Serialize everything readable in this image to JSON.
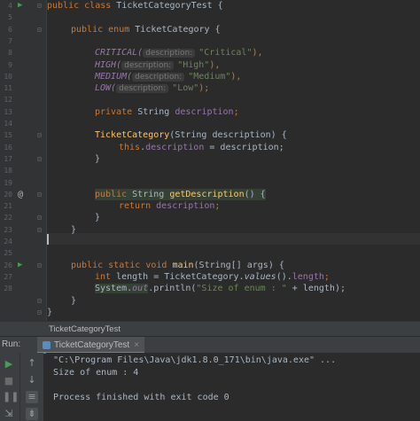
{
  "gutter": {
    "line_numbers": [
      "4",
      "5",
      "6",
      "7",
      "8",
      "9",
      "10",
      "11",
      "12",
      "13",
      "14",
      "15",
      "16",
      "17",
      "18",
      "19",
      "20",
      "21",
      "22",
      "23",
      "24",
      "25",
      "26",
      "27",
      "28"
    ],
    "override_marker": "@"
  },
  "code": {
    "class_decl": {
      "kw1": "public",
      "kw2": "class",
      "name": "TicketCategoryTest {"
    },
    "enum_decl": {
      "kw1": "public",
      "kw2": "enum",
      "name": "TicketCategory {"
    },
    "enums": [
      {
        "name": "CRITICAL(",
        "hint": "description:",
        "value": "\"Critical\"",
        "end": "),"
      },
      {
        "name": "HIGH(",
        "hint": "description:",
        "value": "\"High\"",
        "end": "),"
      },
      {
        "name": "MEDIUM(",
        "hint": "description:",
        "value": "\"Medium\"",
        "end": "),"
      },
      {
        "name": "LOW(",
        "hint": "description:",
        "value": "\"Low\"",
        "end": ");"
      }
    ],
    "field_decl": {
      "kw": "private",
      "type": "String",
      "name": "description",
      "end": ";"
    },
    "ctor_decl": {
      "name": "TicketCategory",
      "params": "(String description) {"
    },
    "ctor_body": {
      "kw": "this",
      "dot": ".",
      "field": "description",
      "rest": " = description;"
    },
    "close_brace": "}",
    "getter_decl": {
      "kw": "public",
      "type": "String",
      "name": "getDescription",
      "rest": "() {"
    },
    "getter_body": {
      "kw": "return",
      "field": "description",
      "end": ";"
    },
    "main_decl": {
      "kw1": "public",
      "kw2": "static",
      "kw3": "void",
      "name": "main",
      "rest": "(String[] args) {"
    },
    "main_line1": {
      "kw": "int",
      "a": " length = TicketCategory.",
      "method": "values",
      "b": "().",
      "field": "length",
      "end": ";"
    },
    "main_line2": {
      "a": "System.",
      "field": "out",
      "b": ".println(",
      "str": "\"Size of enum : \"",
      "c": " + length);"
    }
  },
  "breadcrumb": {
    "label": "TicketCategoryTest"
  },
  "run_panel": {
    "label": "Run:",
    "tab_label": "TicketCategoryTest",
    "close": "×"
  },
  "console": {
    "lines": [
      "\"C:\\Program Files\\Java\\jdk1.8.0_171\\bin\\java.exe\" ...",
      "Size of enum : 4",
      "",
      "Process finished with exit code 0"
    ]
  },
  "colors": {
    "keyword": "#cc7832",
    "field": "#9876aa",
    "string": "#6a8759",
    "function": "#ffc66d",
    "run_green": "#499c54"
  }
}
